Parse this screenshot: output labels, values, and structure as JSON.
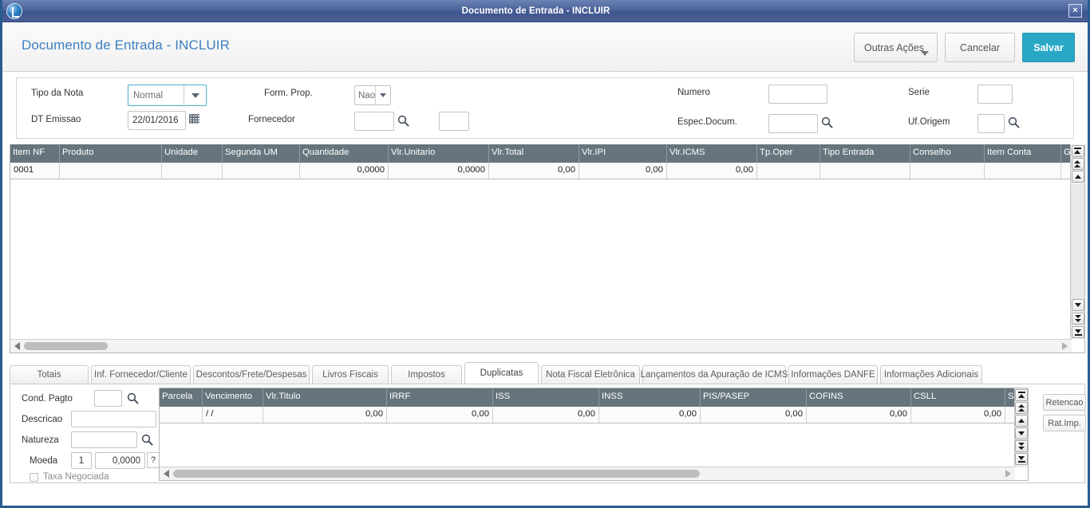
{
  "window": {
    "title": "Documento de Entrada - INCLUIR",
    "close_label": "×",
    "app_icon": "app-logo-icon"
  },
  "header": {
    "page_title": "Documento de Entrada - INCLUIR",
    "buttons": {
      "outras_acoes": "Outras Ações",
      "cancelar": "Cancelar",
      "salvar": "Salvar"
    },
    "accent_color": "#29a8c6",
    "title_color": "#3d7fbe"
  },
  "form": {
    "tipo_da_nota": {
      "label": "Tipo da Nota",
      "value": "Normal"
    },
    "dt_emissao": {
      "label": "DT Emissao",
      "value": "22/01/2016"
    },
    "form_prop": {
      "label": "Form. Prop.",
      "value": "Nao"
    },
    "fornecedor": {
      "label": "Fornecedor",
      "value": ""
    },
    "fornecedor_loja": {
      "value": ""
    },
    "numero": {
      "label": "Numero",
      "value": ""
    },
    "espec_docum": {
      "label": "Espec.Docum.",
      "value": ""
    },
    "serie": {
      "label": "Serie",
      "value": ""
    },
    "uf_origem": {
      "label": "Uf.Origem",
      "value": ""
    }
  },
  "items_grid": {
    "columns": [
      {
        "label": "Item NF",
        "width": 62
      },
      {
        "label": "Produto",
        "width": 128
      },
      {
        "label": "Unidade",
        "width": 76
      },
      {
        "label": "Segunda UM",
        "width": 97
      },
      {
        "label": "Quantidade",
        "width": 111
      },
      {
        "label": "Vlr.Unitario",
        "width": 126
      },
      {
        "label": "Vlr.Total",
        "width": 113
      },
      {
        "label": "Vlr.IPI",
        "width": 110
      },
      {
        "label": "Vlr.ICMS",
        "width": 113
      },
      {
        "label": "Tp.Oper",
        "width": 79
      },
      {
        "label": "Tipo Entrada",
        "width": 113
      },
      {
        "label": "Conselho",
        "width": 93
      },
      {
        "label": "Item Conta",
        "width": 96
      },
      {
        "label": "Grupo",
        "width": 46
      }
    ],
    "rows": [
      {
        "cells": [
          {
            "value": "0001",
            "align": "left"
          },
          {
            "value": "",
            "align": "left"
          },
          {
            "value": "",
            "align": "left"
          },
          {
            "value": "",
            "align": "left"
          },
          {
            "value": "0,0000",
            "align": "right"
          },
          {
            "value": "0,0000",
            "align": "right"
          },
          {
            "value": "0,00",
            "align": "right"
          },
          {
            "value": "0,00",
            "align": "right"
          },
          {
            "value": "0,00",
            "align": "right"
          },
          {
            "value": "",
            "align": "left"
          },
          {
            "value": "",
            "align": "left"
          },
          {
            "value": "",
            "align": "left"
          },
          {
            "value": "",
            "align": "left"
          },
          {
            "value": "",
            "align": "left"
          }
        ]
      }
    ]
  },
  "tabs": [
    {
      "label": "Totais",
      "active": false,
      "width": 99
    },
    {
      "label": "Inf. Fornecedor/Cliente",
      "active": false,
      "width": 125
    },
    {
      "label": "Descontos/Frete/Despesas",
      "active": false,
      "width": 146
    },
    {
      "label": "Livros Fiscais",
      "active": false,
      "width": 96
    },
    {
      "label": "Impostos",
      "active": false,
      "width": 89
    },
    {
      "label": "Duplicatas",
      "active": true,
      "width": 93
    },
    {
      "label": "Nota Fiscal Eletrônica",
      "active": false,
      "width": 124
    },
    {
      "label": "Lançamentos da Apuração de ICMS",
      "active": false,
      "width": 180
    },
    {
      "label": "Informações DANFE",
      "active": false,
      "width": 112
    },
    {
      "label": "Informações Adicionais",
      "active": false,
      "width": 128
    }
  ],
  "duplicatas": {
    "cond_pagto": {
      "label": "Cond. Pagto",
      "value": ""
    },
    "descricao": {
      "label": "Descricao",
      "value": ""
    },
    "natureza": {
      "label": "Natureza",
      "value": ""
    },
    "moeda": {
      "label": "Moeda",
      "value": "1",
      "rate": "0,0000",
      "help": "?"
    },
    "taxa_negociada": {
      "label": "Taxa Negociada",
      "checked": false
    },
    "side_buttons": [
      {
        "label": "Retencao"
      },
      {
        "label": "Rat.Imp."
      }
    ],
    "columns": [
      {
        "label": "Parcela",
        "width": 54
      },
      {
        "label": "Vencimento",
        "width": 76
      },
      {
        "label": "Vlr.Titulo",
        "width": 155
      },
      {
        "label": "IRRF",
        "width": 133
      },
      {
        "label": "ISS",
        "width": 133
      },
      {
        "label": "INSS",
        "width": 127
      },
      {
        "label": "PIS/PASEP",
        "width": 133
      },
      {
        "label": "COFINS",
        "width": 131
      },
      {
        "label": "CSLL",
        "width": 118
      },
      {
        "label": "SE",
        "width": 12
      }
    ],
    "rows": [
      {
        "cells": [
          {
            "value": "",
            "align": "left"
          },
          {
            "value": "/ /",
            "align": "left"
          },
          {
            "value": "0,00",
            "align": "right"
          },
          {
            "value": "0,00",
            "align": "right"
          },
          {
            "value": "0,00",
            "align": "right"
          },
          {
            "value": "0,00",
            "align": "right"
          },
          {
            "value": "0,00",
            "align": "right"
          },
          {
            "value": "0,00",
            "align": "right"
          },
          {
            "value": "0,00",
            "align": "right"
          },
          {
            "value": "",
            "align": "left"
          }
        ]
      }
    ]
  }
}
